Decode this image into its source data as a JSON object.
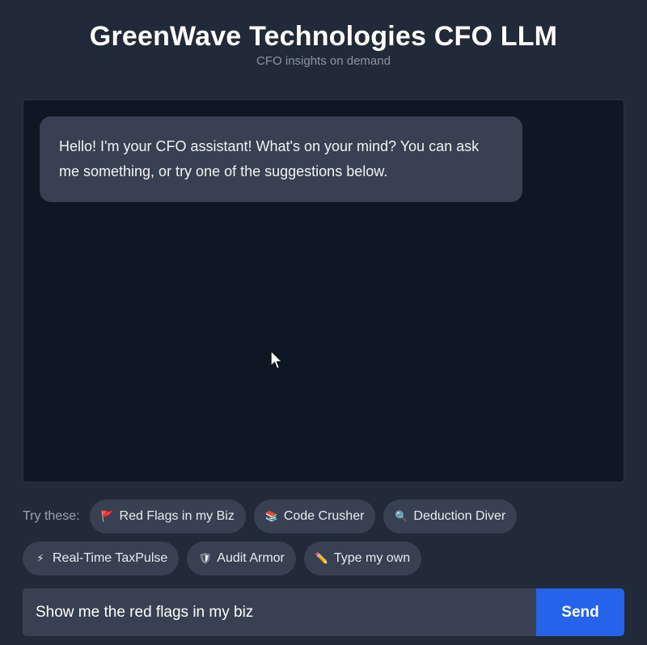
{
  "header": {
    "title": "GreenWave Technologies CFO LLM",
    "subtitle": "CFO insights on demand"
  },
  "chat": {
    "messages": [
      {
        "role": "assistant",
        "text": "Hello! I'm your CFO assistant! What's on your mind? You can ask me something, or try one of the suggestions below."
      }
    ]
  },
  "suggestions": {
    "label": "Try these:",
    "chips": [
      {
        "icon": "red-flag-icon",
        "glyph": "🚩",
        "label": "Red Flags in my Biz"
      },
      {
        "icon": "books-icon",
        "glyph": "📚",
        "label": "Code Crusher"
      },
      {
        "icon": "magnifier-icon",
        "glyph": "🔍",
        "label": "Deduction Diver"
      },
      {
        "icon": "lightning-icon",
        "glyph": "⚡",
        "label": "Real-Time TaxPulse"
      },
      {
        "icon": "shield-icon",
        "glyph": "🛡",
        "label": "Audit Armor"
      },
      {
        "icon": "pencil-icon",
        "glyph": "✏️",
        "label": "Type my own"
      }
    ]
  },
  "composer": {
    "value": "Show me the red flags in my biz",
    "send_label": "Send"
  },
  "colors": {
    "background": "#212a38",
    "chat_panel": "#0f1624",
    "bubble": "#374151",
    "accent": "#2563eb"
  }
}
